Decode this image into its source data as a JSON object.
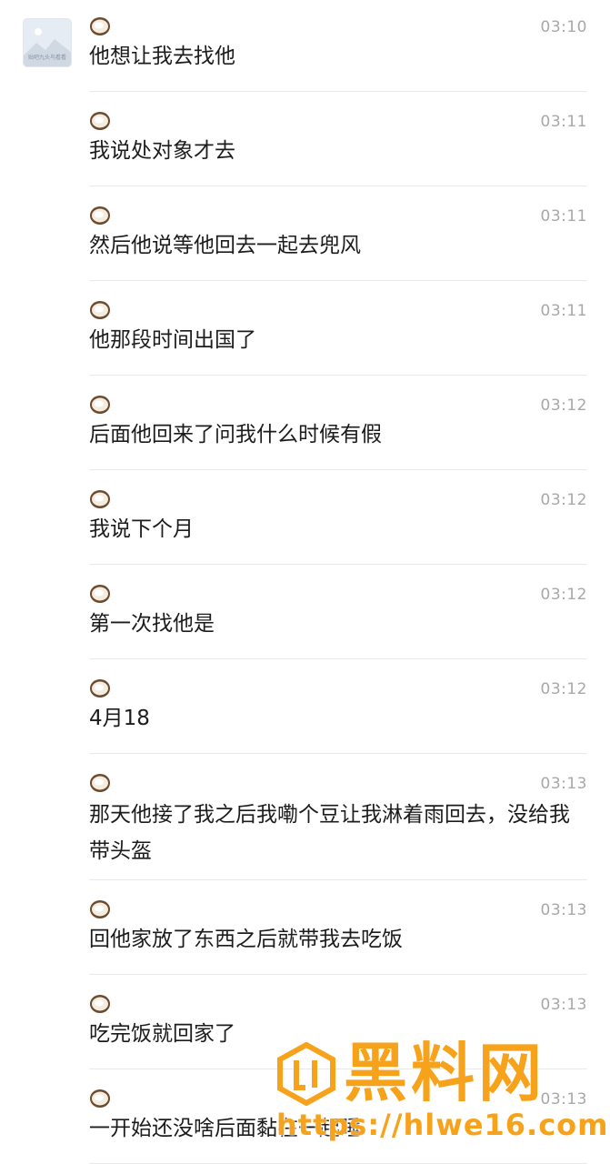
{
  "avatar": {
    "caption": "贴吧九头鸟看看"
  },
  "messages": [
    {
      "time": "03:10",
      "text": "他想让我去找他"
    },
    {
      "time": "03:11",
      "text": "我说处对象才去"
    },
    {
      "time": "03:11",
      "text": "然后他说等他回去一起去兜风"
    },
    {
      "time": "03:11",
      "text": "他那段时间出国了"
    },
    {
      "time": "03:12",
      "text": "后面他回来了问我什么时候有假"
    },
    {
      "time": "03:12",
      "text": "我说下个月"
    },
    {
      "time": "03:12",
      "text": "第一次找他是"
    },
    {
      "time": "03:12",
      "text": "4月18"
    },
    {
      "time": "03:13",
      "text": "那天他接了我之后我嘞个豆让我淋着雨回去，没给我带头盔"
    },
    {
      "time": "03:13",
      "text": "回他家放了东西之后就带我去吃饭"
    },
    {
      "time": "03:13",
      "text": "吃完饭就回家了"
    },
    {
      "time": "03:13",
      "text": "一开始还没啥后面黏在一起睡"
    }
  ],
  "sender_icon": "coconut-icon",
  "watermark": {
    "title": "黑料网",
    "url": "https://hlwe16.com"
  },
  "colors": {
    "time": "#a8a8a8",
    "divider": "#e9e9e9",
    "watermark": "#f7a21b"
  }
}
